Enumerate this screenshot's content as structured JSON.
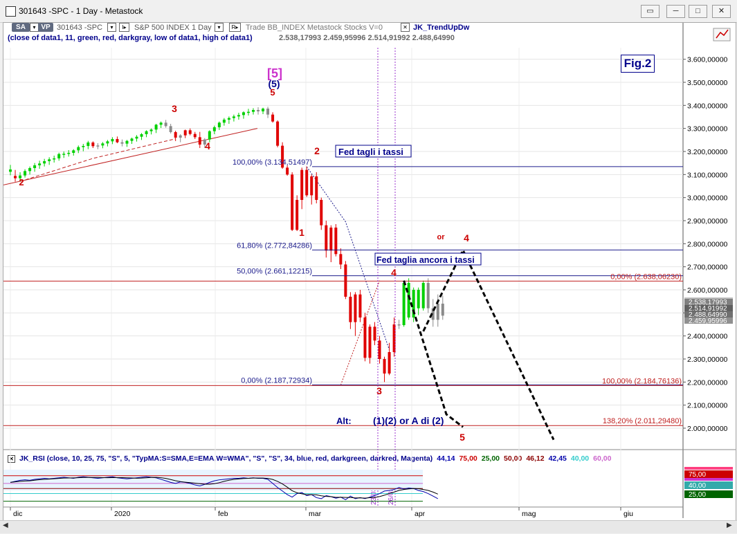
{
  "window": {
    "title": "301643 -SPC - 1 Day - Metastock",
    "buttons": [
      "restore-chart",
      "minimize",
      "maximize",
      "close"
    ]
  },
  "toolbar": {
    "sa": "SA",
    "vp": "VP",
    "symbol": "301643 -SPC",
    "interval_btn": "I▸",
    "security": "S&P 500 INDEX  1 Day",
    "r_btn": "R▸",
    "details": "Trade  BB_INDEX  Metastock  Stocks  V=0",
    "indicator": "JK_TrendUpDw"
  },
  "info_line": {
    "text": "(close of data1, 11, green, red, darkgray, low of data1, high of data1)",
    "values": "2.538,17993  2.459,95996  2.514,91992  2.488,64990"
  },
  "rsi_header": {
    "text": "JK_RSI   (close, 10, 25, 75, \"S\", 5, \"TypMA:S=SMA,E=EMA,W=WMA\", \"S\", \"S\", 34, blue, red, darkgreen, darkred, Magenta)",
    "values": [
      {
        "v": "44,14",
        "color": "#0000aa"
      },
      {
        "v": "75,00",
        "color": "#cc0000"
      },
      {
        "v": "25,00",
        "color": "#006400"
      },
      {
        "v": "50,00",
        "color": "#8b0000"
      },
      {
        "v": "46,12",
        "color": "#8b0000"
      },
      {
        "v": "42,45",
        "color": "#0000aa"
      },
      {
        "v": "40,00",
        "color": "#33cccc"
      },
      {
        "v": "60,00",
        "color": "#cc66cc"
      }
    ]
  },
  "fig_label": "Fig.2",
  "chart_data": {
    "type": "candlestick",
    "y_axis_labels": [
      "3.600,00000",
      "3.500,00000",
      "3.400,00000",
      "3.300,00000",
      "3.200,00000",
      "3.100,00000",
      "3.000,00000",
      "2.900,00000",
      "2.800,00000",
      "2.700,00000",
      "2.600,00000",
      "2.500,00000",
      "2.400,00000",
      "2.300,00000",
      "2.200,00000",
      "2.100,00000",
      "2.000,00000"
    ],
    "x_axis_labels": [
      "dic",
      "2020",
      "feb",
      "mar",
      "apr",
      "mag",
      "giu"
    ],
    "ylim": [
      1910,
      3650
    ],
    "candles": [
      [
        3112,
        3142,
        3097,
        3122,
        "up"
      ],
      [
        3094,
        3120,
        3069,
        3084,
        "down"
      ],
      [
        3084,
        3110,
        3070,
        3096,
        "up"
      ],
      [
        3096,
        3123,
        3087,
        3115,
        "up"
      ],
      [
        3115,
        3135,
        3100,
        3128,
        "up"
      ],
      [
        3128,
        3150,
        3112,
        3140,
        "up"
      ],
      [
        3140,
        3160,
        3125,
        3148,
        "up"
      ],
      [
        3148,
        3168,
        3135,
        3158,
        "up"
      ],
      [
        3158,
        3175,
        3142,
        3166,
        "up"
      ],
      [
        3166,
        3182,
        3152,
        3170,
        "up"
      ],
      [
        3170,
        3195,
        3160,
        3189,
        "up"
      ],
      [
        3189,
        3200,
        3172,
        3190,
        "up"
      ],
      [
        3190,
        3206,
        3178,
        3194,
        "up"
      ],
      [
        3194,
        3210,
        3182,
        3205,
        "up"
      ],
      [
        3205,
        3226,
        3193,
        3219,
        "up"
      ],
      [
        3219,
        3233,
        3201,
        3224,
        "up"
      ],
      [
        3224,
        3246,
        3210,
        3239,
        "up"
      ],
      [
        3239,
        3244,
        3215,
        3223,
        "down"
      ],
      [
        3223,
        3236,
        3210,
        3226,
        "gray"
      ],
      [
        3226,
        3241,
        3214,
        3235,
        "up"
      ],
      [
        3235,
        3250,
        3222,
        3244,
        "up"
      ],
      [
        3244,
        3262,
        3232,
        3254,
        "up"
      ],
      [
        3254,
        3265,
        3236,
        3240,
        "down"
      ],
      [
        3240,
        3252,
        3222,
        3234,
        "gray"
      ],
      [
        3234,
        3250,
        3220,
        3246,
        "up"
      ],
      [
        3246,
        3260,
        3233,
        3256,
        "up"
      ],
      [
        3256,
        3271,
        3243,
        3264,
        "up"
      ],
      [
        3264,
        3280,
        3250,
        3275,
        "up"
      ],
      [
        3275,
        3292,
        3262,
        3288,
        "up"
      ],
      [
        3288,
        3300,
        3274,
        3295,
        "up"
      ],
      [
        3295,
        3320,
        3280,
        3316,
        "up"
      ],
      [
        3316,
        3330,
        3302,
        3325,
        "up"
      ],
      [
        3325,
        3337,
        3303,
        3310,
        "gray"
      ],
      [
        3310,
        3320,
        3278,
        3284,
        "gray"
      ],
      [
        3284,
        3290,
        3245,
        3260,
        "down"
      ],
      [
        3260,
        3275,
        3240,
        3270,
        "gray"
      ],
      [
        3270,
        3295,
        3258,
        3292,
        "down"
      ],
      [
        3292,
        3300,
        3270,
        3276,
        "down"
      ],
      [
        3276,
        3285,
        3254,
        3262,
        "down"
      ],
      [
        3262,
        3285,
        3215,
        3230,
        "down"
      ],
      [
        3230,
        3258,
        3215,
        3252,
        "gray"
      ],
      [
        3252,
        3292,
        3240,
        3288,
        "up"
      ],
      [
        3288,
        3312,
        3275,
        3305,
        "up"
      ],
      [
        3305,
        3330,
        3293,
        3325,
        "up"
      ],
      [
        3325,
        3345,
        3312,
        3338,
        "up"
      ],
      [
        3338,
        3352,
        3320,
        3345,
        "up"
      ],
      [
        3345,
        3360,
        3330,
        3352,
        "up"
      ],
      [
        3352,
        3368,
        3338,
        3358,
        "up"
      ],
      [
        3358,
        3374,
        3342,
        3370,
        "up"
      ],
      [
        3370,
        3385,
        3356,
        3372,
        "up"
      ],
      [
        3372,
        3388,
        3360,
        3380,
        "up"
      ],
      [
        3380,
        3392,
        3360,
        3374,
        "gray"
      ],
      [
        3374,
        3390,
        3362,
        3386,
        "up"
      ],
      [
        3386,
        3394,
        3345,
        3360,
        "gray"
      ],
      [
        3360,
        3370,
        3325,
        3330,
        "down"
      ],
      [
        3330,
        3335,
        3218,
        3225,
        "down"
      ],
      [
        3225,
        3240,
        3125,
        3130,
        "down"
      ],
      [
        3130,
        3140,
        3095,
        3100,
        "down"
      ],
      [
        3100,
        3110,
        2855,
        2860,
        "down"
      ],
      [
        2860,
        3010,
        2855,
        2990,
        "down"
      ],
      [
        2990,
        3130,
        2950,
        3120,
        "down"
      ],
      [
        3120,
        3135,
        3003,
        3010,
        "down"
      ],
      [
        3010,
        3100,
        2970,
        3092,
        "down"
      ],
      [
        3092,
        3110,
        2975,
        2990,
        "down"
      ],
      [
        2990,
        3000,
        2860,
        2880,
        "down"
      ],
      [
        2880,
        2900,
        2740,
        2770,
        "down"
      ],
      [
        2770,
        2880,
        2720,
        2870,
        "down"
      ],
      [
        2870,
        2885,
        2745,
        2755,
        "down"
      ],
      [
        2755,
        2780,
        2690,
        2710,
        "down"
      ],
      [
        2710,
        2725,
        2560,
        2570,
        "down"
      ],
      [
        2570,
        2590,
        2430,
        2460,
        "down"
      ],
      [
        2460,
        2590,
        2400,
        2580,
        "down"
      ],
      [
        2580,
        2600,
        2460,
        2480,
        "down"
      ],
      [
        2480,
        2500,
        2290,
        2305,
        "down"
      ],
      [
        2305,
        2450,
        2280,
        2440,
        "down"
      ],
      [
        2440,
        2460,
        2360,
        2380,
        "down"
      ],
      [
        2380,
        2400,
        2280,
        2300,
        "down"
      ],
      [
        2300,
        2310,
        2200,
        2237,
        "down"
      ],
      [
        2237,
        2370,
        2230,
        2330,
        "down"
      ],
      [
        2330,
        2480,
        2310,
        2450,
        "down"
      ],
      [
        2450,
        2470,
        2430,
        2447,
        "gray"
      ],
      [
        2447,
        2640,
        2440,
        2630,
        "up"
      ],
      [
        2630,
        2650,
        2470,
        2480,
        "up"
      ],
      [
        2480,
        2610,
        2460,
        2600,
        "up"
      ],
      [
        2600,
        2610,
        2490,
        2520,
        "up"
      ],
      [
        2520,
        2640,
        2510,
        2630,
        "up"
      ],
      [
        2630,
        2650,
        2500,
        2520,
        "gray"
      ],
      [
        2520,
        2560,
        2440,
        2470,
        "gray"
      ],
      [
        2470,
        2580,
        2440,
        2540,
        "gray"
      ],
      [
        2540,
        2575,
        2470,
        2488,
        "gray"
      ]
    ],
    "retracement_levels": [
      {
        "label": "100,00% (3.134,51497)",
        "value": 3134.51,
        "color": "#1c1c8c"
      },
      {
        "label": "61,80% (2.772,84286)",
        "value": 2772.84,
        "color": "#1c1c8c"
      },
      {
        "label": "50,00% (2.661,12215)",
        "value": 2661.12,
        "color": "#1c1c8c"
      },
      {
        "label": "0,00% (2.187,72934)",
        "value": 2187.73,
        "color": "#1c1c8c"
      }
    ],
    "projection_levels": [
      {
        "label": "0,00% (2.638,06230)",
        "value": 2638.06,
        "color": "#c02020"
      },
      {
        "label": "100,00% (2.184,76136)",
        "value": 2184.76,
        "color": "#c02020"
      },
      {
        "label": "138,20% (2.011,29480)",
        "value": 2011.29,
        "color": "#c02020"
      }
    ],
    "wave_labels": [
      {
        "text": "2",
        "color": "#cc0000"
      },
      {
        "text": "3",
        "color": "#cc0000"
      },
      {
        "text": "4",
        "color": "#cc0000"
      },
      {
        "text": "[5]",
        "color": "#cc33cc"
      },
      {
        "text": "(5)",
        "color": "#00008b"
      },
      {
        "text": "5",
        "color": "#cc0000"
      },
      {
        "text": "2",
        "color": "#cc0000"
      },
      {
        "text": "1",
        "color": "#cc0000"
      },
      {
        "text": "4",
        "color": "#cc0000"
      },
      {
        "text": "3",
        "color": "#cc0000"
      },
      {
        "text": "4",
        "color": "#cc0000"
      },
      {
        "text": "or",
        "color": "#cc0000"
      },
      {
        "text": "5",
        "color": "#cc0000"
      }
    ],
    "annotations": {
      "fed1": "Fed tagli i tassi",
      "fed2": "Fed taglia ancora i tassi",
      "alt": "Alt:",
      "alt_text": "(1)(2) or A di (2)"
    },
    "price_tags": [
      "2.538,17993",
      "2.514,91992",
      "2.488,64990",
      "2.459,95996"
    ],
    "dates_vertical": [
      "23/03/2020",
      "26/03/2020"
    ],
    "rsi_tags": [
      {
        "v": "75,00",
        "color": "#cc0000"
      },
      {
        "v": "40,00",
        "color": "#33aaaa"
      },
      {
        "v": "25,00",
        "color": "#006400"
      }
    ]
  }
}
